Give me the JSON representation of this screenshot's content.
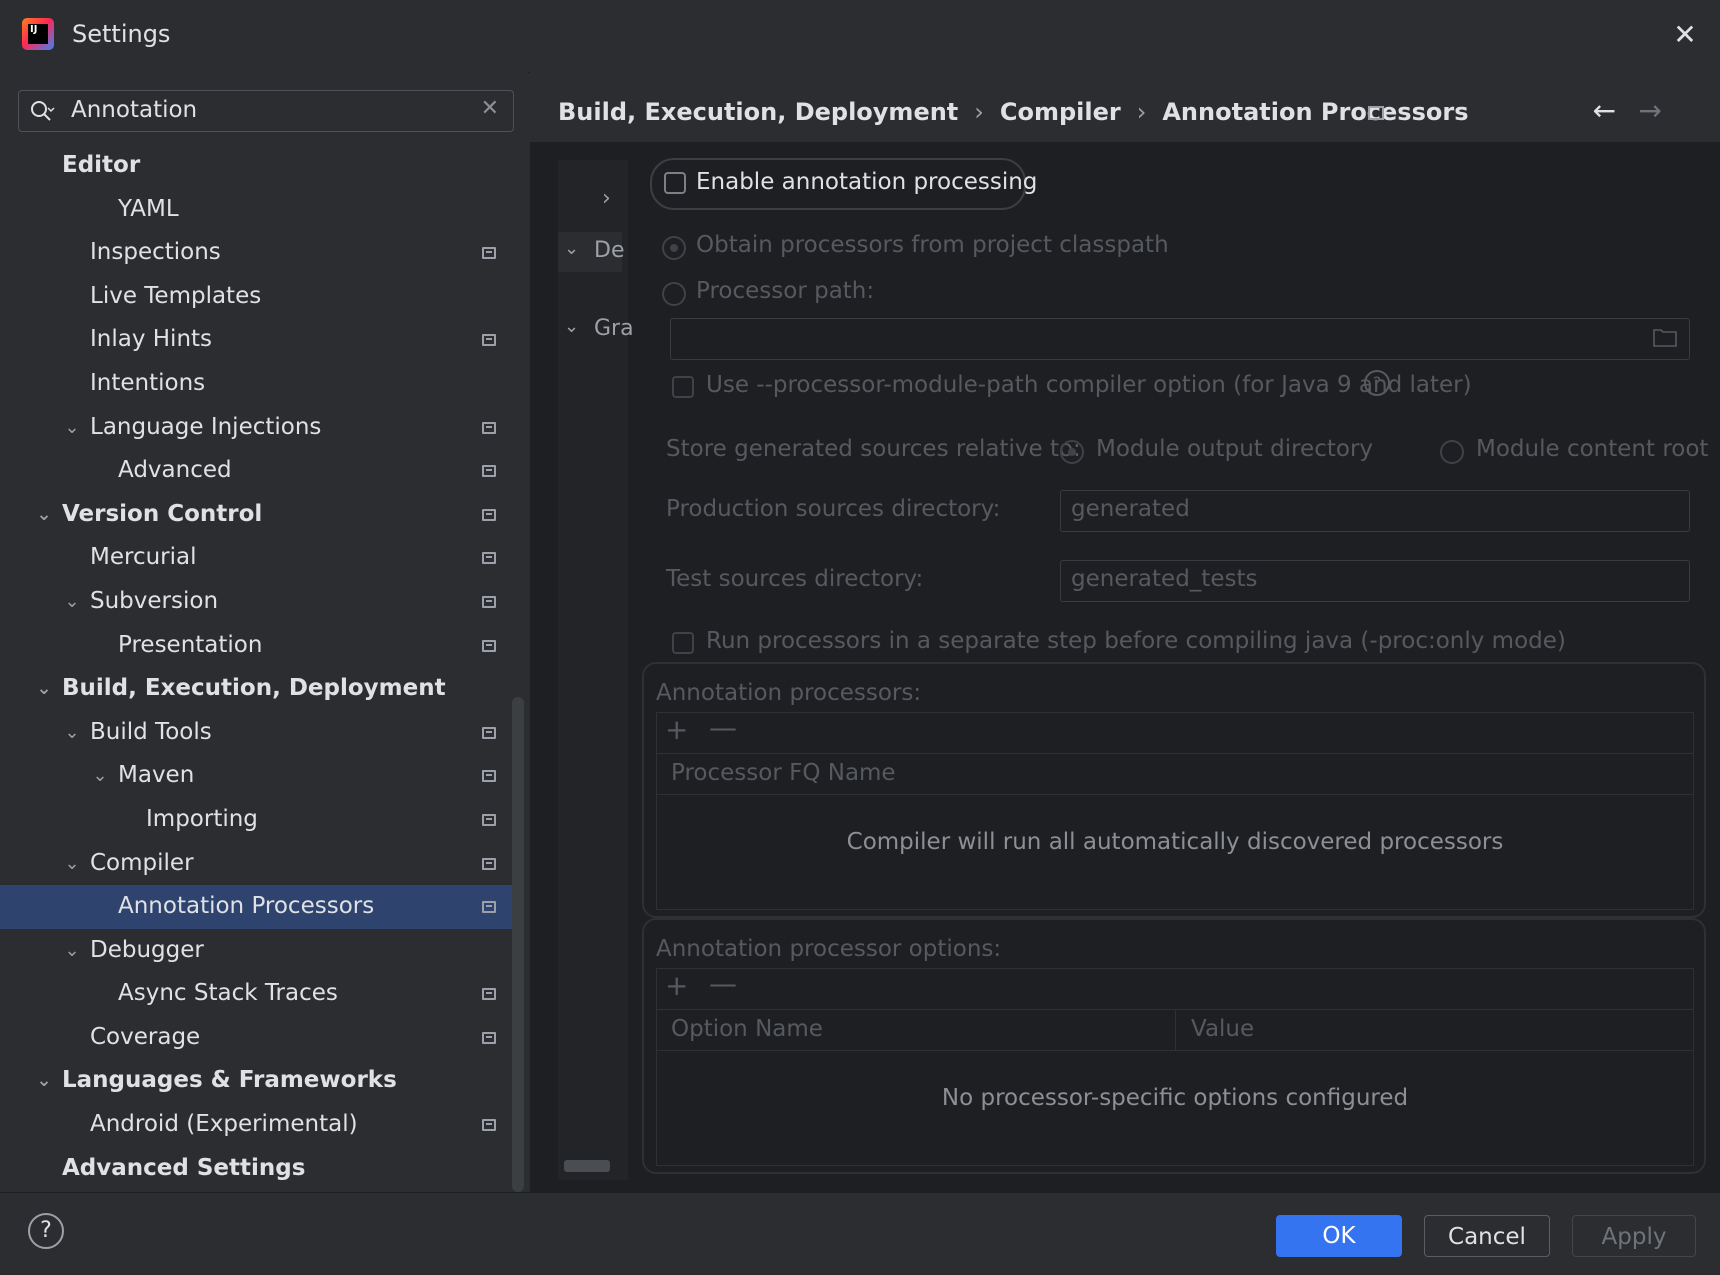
{
  "window": {
    "title": "Settings"
  },
  "search": {
    "value": "Annotation"
  },
  "tree": [
    {
      "label": "Editor",
      "bold": true,
      "level": 0,
      "chevron": false,
      "pin": false
    },
    {
      "label": "YAML",
      "bold": false,
      "level": 2,
      "chevron": false,
      "pin": false
    },
    {
      "label": "Inspections",
      "bold": false,
      "level": 1,
      "chevron": false,
      "pin": true
    },
    {
      "label": "Live Templates",
      "bold": false,
      "level": 1,
      "chevron": false,
      "pin": false
    },
    {
      "label": "Inlay Hints",
      "bold": false,
      "level": 1,
      "chevron": false,
      "pin": true
    },
    {
      "label": "Intentions",
      "bold": false,
      "level": 1,
      "chevron": false,
      "pin": false
    },
    {
      "label": "Language Injections",
      "bold": false,
      "level": 1,
      "chevron": true,
      "pin": true
    },
    {
      "label": "Advanced",
      "bold": false,
      "level": 2,
      "chevron": false,
      "pin": true
    },
    {
      "label": "Version Control",
      "bold": true,
      "level": 0,
      "chevron": true,
      "pin": true
    },
    {
      "label": "Mercurial",
      "bold": false,
      "level": 1,
      "chevron": false,
      "pin": true
    },
    {
      "label": "Subversion",
      "bold": false,
      "level": 1,
      "chevron": true,
      "pin": true
    },
    {
      "label": "Presentation",
      "bold": false,
      "level": 2,
      "chevron": false,
      "pin": true
    },
    {
      "label": "Build, Execution, Deployment",
      "bold": true,
      "level": 0,
      "chevron": true,
      "pin": false
    },
    {
      "label": "Build Tools",
      "bold": false,
      "level": 1,
      "chevron": true,
      "pin": true
    },
    {
      "label": "Maven",
      "bold": false,
      "level": 2,
      "chevron": true,
      "pin": true
    },
    {
      "label": "Importing",
      "bold": false,
      "level": 3,
      "chevron": false,
      "pin": true
    },
    {
      "label": "Compiler",
      "bold": false,
      "level": 1,
      "chevron": true,
      "pin": true
    },
    {
      "label": "Annotation Processors",
      "bold": false,
      "level": 2,
      "chevron": false,
      "pin": true,
      "selected": true
    },
    {
      "label": "Debugger",
      "bold": false,
      "level": 1,
      "chevron": true,
      "pin": false
    },
    {
      "label": "Async Stack Traces",
      "bold": false,
      "level": 2,
      "chevron": false,
      "pin": true
    },
    {
      "label": "Coverage",
      "bold": false,
      "level": 1,
      "chevron": false,
      "pin": true
    },
    {
      "label": "Languages & Frameworks",
      "bold": true,
      "level": 0,
      "chevron": true,
      "pin": false
    },
    {
      "label": "Android (Experimental)",
      "bold": false,
      "level": 1,
      "chevron": false,
      "pin": true
    },
    {
      "label": "Advanced Settings",
      "bold": true,
      "level": 0,
      "chevron": false,
      "pin": false
    }
  ],
  "breadcrumb": {
    "parts": [
      "Build, Execution, Deployment",
      "Compiler",
      "Annotation Processors"
    ],
    "separator": "›"
  },
  "mini_panel": {
    "row1": "De",
    "row2": "Gra"
  },
  "form": {
    "enable_label": "Enable annotation processing",
    "obtain_label": "Obtain processors from project classpath",
    "processor_path_label": "Processor path:",
    "module_path_label": "Use --processor-module-path compiler option (for Java 9 and later)",
    "store_label": "Store generated sources relative to:",
    "module_output_label": "Module output directory",
    "module_content_label": "Module content root",
    "production_label": "Production sources directory:",
    "production_value": "generated",
    "test_label": "Test sources directory:",
    "test_value": "generated_tests",
    "proc_only_label": "Run processors in a separate step before compiling java (-proc:only mode)"
  },
  "processors": {
    "title": "Annotation processors:",
    "column": "Processor FQ Name",
    "empty": "Compiler will run all automatically discovered processors"
  },
  "options": {
    "title": "Annotation processor options:",
    "col_name": "Option Name",
    "col_value": "Value",
    "empty": "No processor-specific options configured"
  },
  "footer": {
    "ok": "OK",
    "cancel": "Cancel",
    "apply": "Apply",
    "help": "?"
  },
  "colors": {
    "accent": "#3574f0",
    "selection": "#2e436e"
  }
}
